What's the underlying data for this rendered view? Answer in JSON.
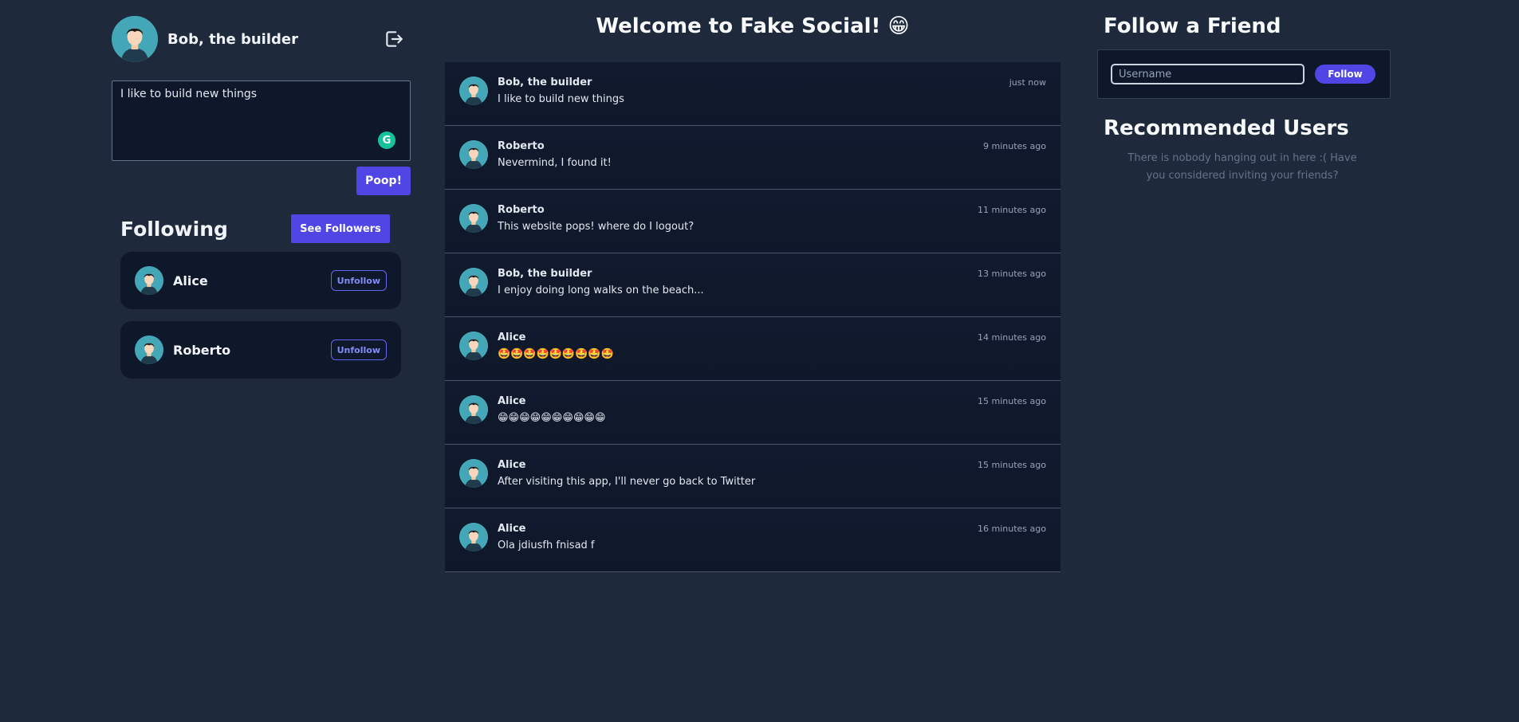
{
  "profile": {
    "name": "Bob, the builder",
    "icons": {
      "avatar": "avatar-icon",
      "logout": "logout-icon"
    }
  },
  "composer": {
    "value": "I like to build new things",
    "submit_label": "Poop!",
    "grammarly_icon": "grammarly-icon"
  },
  "following": {
    "title": "Following",
    "see_followers_label": "See Followers",
    "items": [
      {
        "name": "Alice",
        "action_label": "Unfollow"
      },
      {
        "name": "Roberto",
        "action_label": "Unfollow"
      }
    ]
  },
  "feed": {
    "title": "Welcome to Fake Social! 😁",
    "posts": [
      {
        "author": "Bob, the builder",
        "text": "I like to build new things",
        "time": "just now"
      },
      {
        "author": "Roberto",
        "text": "Nevermind, I found it!",
        "time": "9 minutes ago"
      },
      {
        "author": "Roberto",
        "text": "This website pops! where do I logout?",
        "time": "11 minutes ago"
      },
      {
        "author": "Bob, the builder",
        "text": "I enjoy doing long walks on the beach...",
        "time": "13 minutes ago"
      },
      {
        "author": "Alice",
        "text": "🤩🤩🤩🤩🤩🤩🤩🤩🤩",
        "time": "14 minutes ago"
      },
      {
        "author": "Alice",
        "text": "😁😁😁😁😁😁😁😁😁😁",
        "time": "15 minutes ago"
      },
      {
        "author": "Alice",
        "text": "After visiting this app, I'll never go back to Twitter",
        "time": "15 minutes ago"
      },
      {
        "author": "Alice",
        "text": "Ola jdiusfh fnisad f",
        "time": "16 minutes ago"
      }
    ]
  },
  "follow_friend": {
    "title": "Follow a Friend",
    "input_placeholder": "Username",
    "input_value": "",
    "button_label": "Follow"
  },
  "recommended": {
    "title": "Recommended Users",
    "empty_text": "There is nobody hanging out in here :( Have you considered inviting your friends?"
  },
  "colors": {
    "background": "#1e293b",
    "panel": "#0f172a",
    "accent": "#4f46e5",
    "avatar_bg": "#44a7b7"
  }
}
